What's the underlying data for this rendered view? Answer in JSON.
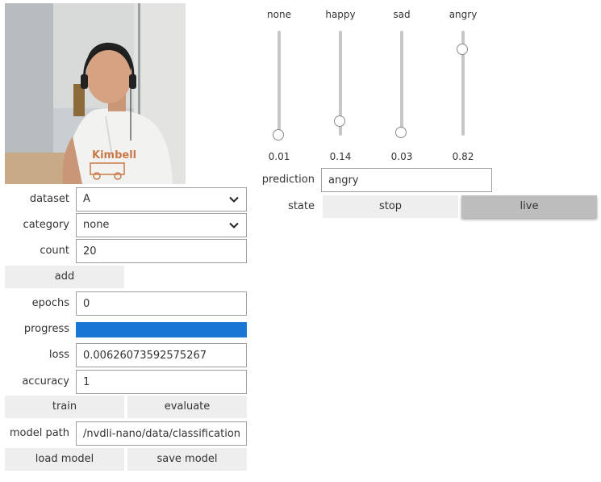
{
  "camera": {
    "shirt_text": "Kimbell"
  },
  "form": {
    "dataset": {
      "label": "dataset",
      "value": "A"
    },
    "category": {
      "label": "category",
      "value": "none"
    },
    "count": {
      "label": "count",
      "value": "20"
    },
    "add_label": "add",
    "epochs": {
      "label": "epochs",
      "value": "0"
    },
    "progress": {
      "label": "progress",
      "value": 1.0
    },
    "loss": {
      "label": "loss",
      "value": "0.00626073592575267"
    },
    "accuracy": {
      "label": "accuracy",
      "value": "1"
    },
    "train_label": "train",
    "evaluate_label": "evaluate",
    "model_path": {
      "label": "model path",
      "value": "/nvdli-nano/data/classification/my_"
    },
    "load_label": "load model",
    "save_label": "save model"
  },
  "sliders": [
    {
      "name": "none",
      "value": "0.01",
      "level": 0.01
    },
    {
      "name": "happy",
      "value": "0.14",
      "level": 0.14
    },
    {
      "name": "sad",
      "value": "0.03",
      "level": 0.03
    },
    {
      "name": "angry",
      "value": "0.82",
      "level": 0.82
    }
  ],
  "prediction": {
    "label": "prediction",
    "value": "angry"
  },
  "state": {
    "label": "state",
    "stop_label": "stop",
    "live_label": "live",
    "active": "live"
  },
  "colors": {
    "progress_fill": "#1976d2",
    "button_bg": "#eeeeee",
    "active_button_bg": "#bdbdbd"
  }
}
